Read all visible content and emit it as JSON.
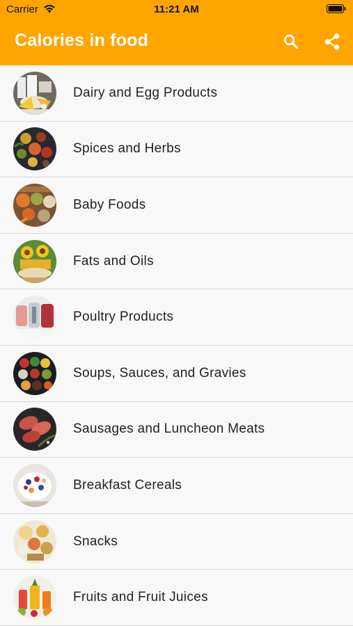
{
  "status_bar": {
    "carrier": "Carrier",
    "time": "11:21 AM"
  },
  "app_bar": {
    "title": "Calories in food",
    "color": "#ffa500",
    "actions": [
      "search-icon",
      "share-icon"
    ]
  },
  "categories": [
    {
      "label": "Dairy and Egg Products"
    },
    {
      "label": "Spices and Herbs"
    },
    {
      "label": "Baby Foods"
    },
    {
      "label": "Fats and Oils"
    },
    {
      "label": "Poultry Products"
    },
    {
      "label": "Soups, Sauces, and Gravies"
    },
    {
      "label": "Sausages and Luncheon Meats"
    },
    {
      "label": "Breakfast Cereals"
    },
    {
      "label": "Snacks"
    },
    {
      "label": "Fruits and Fruit Juices"
    }
  ]
}
